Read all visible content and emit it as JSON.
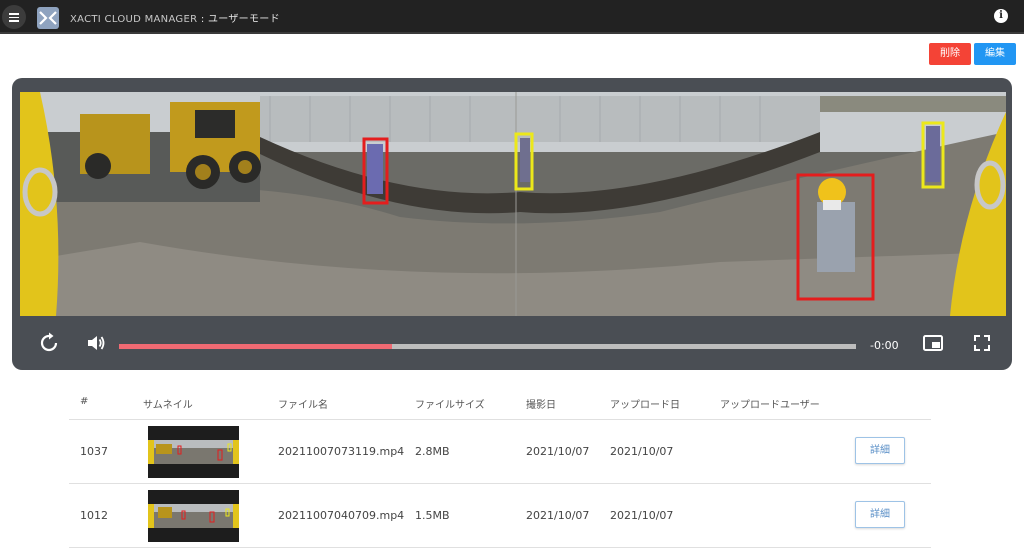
{
  "header": {
    "brand": "XACTI CLOUD MANAGER",
    "separator": " : ",
    "mode": "ユーザーモード"
  },
  "actions": {
    "delete_label": "削除",
    "edit_label": "編集"
  },
  "player": {
    "time": "-0:00",
    "progress": 0.37
  },
  "table": {
    "headers": [
      "#",
      "サムネイル",
      "ファイル名",
      "ファイルサイズ",
      "撮影日",
      "アップロード日",
      "アップロードユーザー"
    ],
    "rows": [
      {
        "id": "1037",
        "filename": "20211007073119.mp4",
        "size": "2.8MB",
        "shot_date": "2021/10/07",
        "upload_date": "2021/10/07",
        "user": "",
        "detail_label": "詳細"
      },
      {
        "id": "1012",
        "filename": "20211007040709.mp4",
        "size": "1.5MB",
        "shot_date": "2021/10/07",
        "upload_date": "2021/10/07",
        "user": "",
        "detail_label": "詳細"
      }
    ]
  },
  "colors": {
    "topbar": "#222222",
    "delete": "#f44336",
    "edit": "#2196f3",
    "progress_played": "#f06a73",
    "progress_rest": "#bdbdbd",
    "player_bg": "#4a4e54"
  }
}
